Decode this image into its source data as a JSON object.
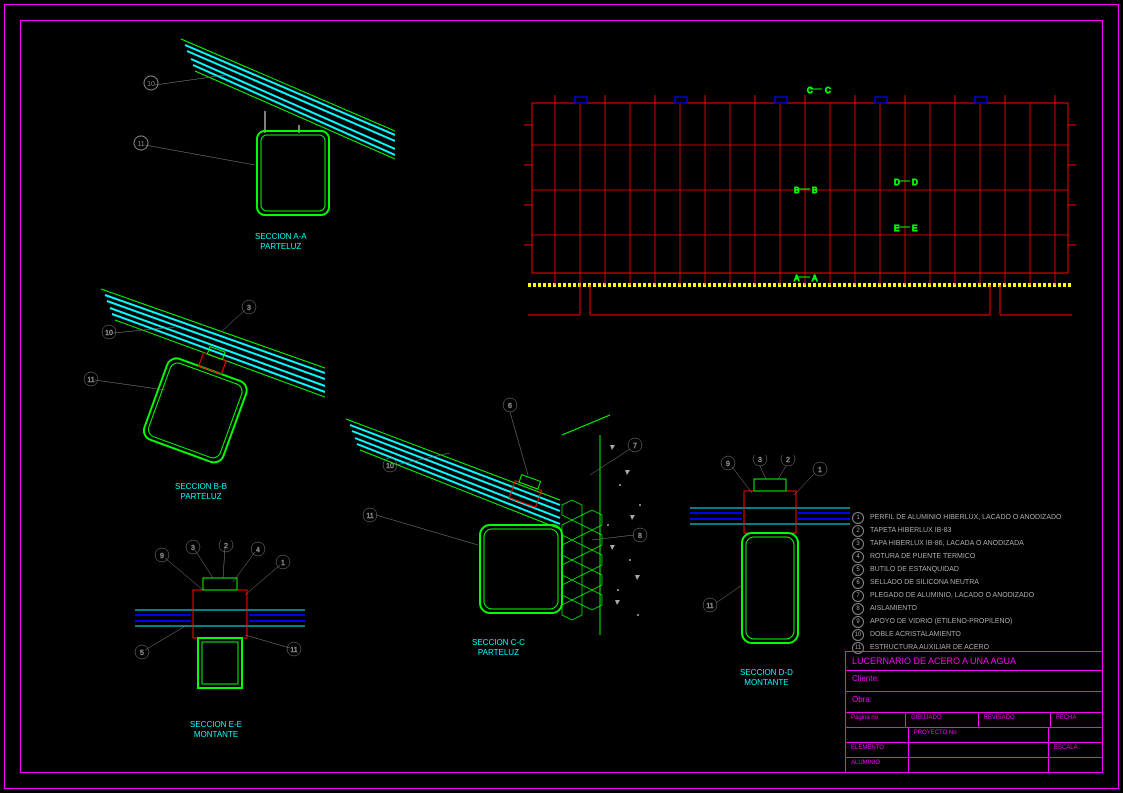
{
  "drawing": {
    "title": "LUCERNARIO DE ACERO A UNA AGUA",
    "client_label": "Cliente:",
    "obra_label": "Obra:",
    "fields": {
      "page": "Página no",
      "dibujado": "DIBUJADO",
      "revisado": "REVISADO",
      "fecha": "FECHA",
      "proyecto": "PROYECTO No",
      "elemento": "ELEMENTO",
      "escala": "ESCALA",
      "aluminio": "ALUMINIO"
    }
  },
  "sections": {
    "aa": {
      "label1": "SECCION A-A",
      "label2": "PARTELUZ"
    },
    "bb": {
      "label1": "SECCION B-B",
      "label2": "PARTELUZ"
    },
    "cc": {
      "label1": "SECCION C-C",
      "label2": "PARTELUZ"
    },
    "dd": {
      "label1": "SECCION D-D",
      "label2": "MONTANTE"
    },
    "ee": {
      "label1": "SECCION E-E",
      "label2": "MONTANTE"
    }
  },
  "legend": [
    {
      "num": "1",
      "text": "PERFIL DE ALUMINIO HIBERLUX, LACADO O ANODIZADO"
    },
    {
      "num": "2",
      "text": "TAPETA HIBERLUX IB-83"
    },
    {
      "num": "3",
      "text": "TAPA HIBERLUX IB-86, LACADA O ANODIZADA"
    },
    {
      "num": "4",
      "text": "ROTURA DE PUENTE TERMICO"
    },
    {
      "num": "5",
      "text": "BUTILO DE ESTANQUIDAD"
    },
    {
      "num": "6",
      "text": "SELLADO DE SILICONA NEUTRA"
    },
    {
      "num": "7",
      "text": "PLEGADO DE ALUMINIO, LACADO O ANODIZADO"
    },
    {
      "num": "8",
      "text": "AISLAMIENTO"
    },
    {
      "num": "9",
      "text": "APOYO DE VIDRIO (ETILENO-PROPILENO)"
    },
    {
      "num": "10",
      "text": "DOBLE ACRISTALAMIENTO"
    },
    {
      "num": "11",
      "text": "ESTRUCTURA AUXILIAR DE ACERO"
    }
  ],
  "plan_markers": {
    "a": "A",
    "b": "B",
    "c": "C",
    "d": "D",
    "e": "E"
  }
}
